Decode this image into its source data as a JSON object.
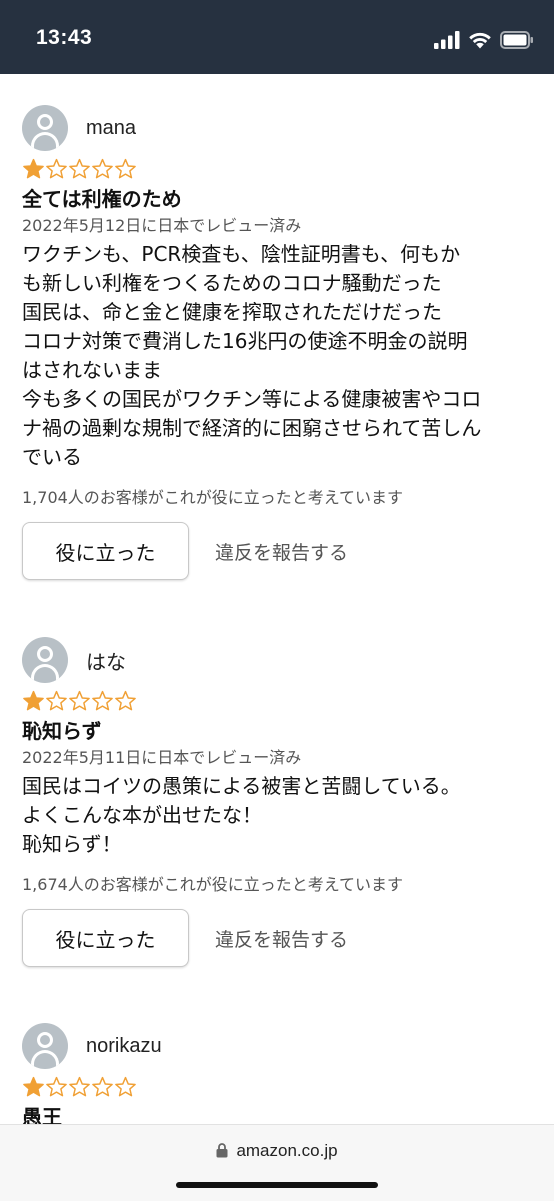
{
  "status_bar": {
    "time": "13:43"
  },
  "reviews": [
    {
      "name": "mana",
      "rating": 1,
      "max_rating": 5,
      "title": "全ては利権のため",
      "date": "2022年5月12日に日本でレビュー済み",
      "body": [
        "ワクチンも、PCR検査も、陰性証明書も、何もか",
        "も新しい利権をつくるためのコロナ騒動だった",
        "国民は、命と金と健康を搾取されただけだった",
        "コロナ対策で費消した16兆円の使途不明金の説明",
        "はされないまま",
        "今も多くの国民がワクチン等による健康被害やコロ",
        "ナ禍の過剰な規制で経済的に困窮させられて苦しん",
        "でいる"
      ],
      "helpful_count": "1,704人のお客様がこれが役に立ったと考えています",
      "helpful_label": "役に立った",
      "report_label": "違反を報告する"
    },
    {
      "name": "はな",
      "rating": 1,
      "max_rating": 5,
      "title": "恥知らず",
      "date": "2022年5月11日に日本でレビュー済み",
      "body": [
        "国民はコイツの愚策による被害と苦闘している。",
        "よくこんな本が出せたな！",
        "恥知らず！"
      ],
      "helpful_count": "1,674人のお客様がこれが役に立ったと考えています",
      "helpful_label": "役に立った",
      "report_label": "違反を報告する"
    },
    {
      "name": "norikazu",
      "rating": 1,
      "max_rating": 5,
      "title": "愚王"
    }
  ],
  "browser": {
    "url": "amazon.co.jp"
  },
  "colors": {
    "star": "#f0a035",
    "status_bar_bg": "#263140"
  }
}
